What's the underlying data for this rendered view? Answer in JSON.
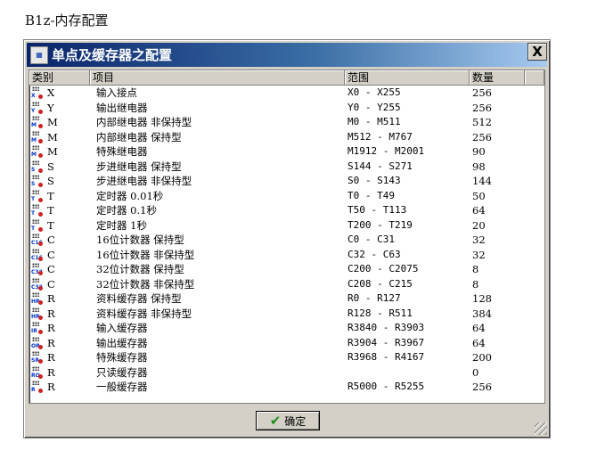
{
  "caption": "B1z-内存配置",
  "window": {
    "title": "单点及缓存器之配置",
    "close_label": "X",
    "ok_label": "确定"
  },
  "columns": [
    "类别",
    "项目",
    "范围",
    "数量"
  ],
  "rows": [
    {
      "icon": "X",
      "type": "X",
      "item": "输入接点",
      "range": "X0 - X255",
      "count": "256"
    },
    {
      "icon": "Y",
      "type": "Y",
      "item": "输出继电器",
      "range": "Y0 - Y255",
      "count": "256"
    },
    {
      "icon": "M",
      "type": "M",
      "item": "内部继电器 非保持型",
      "range": "M0 - M511",
      "count": "512"
    },
    {
      "icon": "M",
      "type": "M",
      "item": "内部继电器 保持型",
      "range": "M512 - M767",
      "count": "256"
    },
    {
      "icon": "M",
      "type": "M",
      "item": "特殊继电器",
      "range": "M1912 - M2001",
      "count": "90"
    },
    {
      "icon": "S",
      "type": "S",
      "item": "步进继电器 保持型",
      "range": "S144 - S271",
      "count": "98"
    },
    {
      "icon": "S",
      "type": "S",
      "item": "步进继电器 非保持型",
      "range": "S0 - S143",
      "count": "144"
    },
    {
      "icon": "T",
      "type": "T",
      "item": "定时器 0.01秒",
      "range": "T0 - T49",
      "count": "50"
    },
    {
      "icon": "T",
      "type": "T",
      "item": "定时器 0.1秒",
      "range": "T50 - T113",
      "count": "64"
    },
    {
      "icon": "T",
      "type": "T",
      "item": "定时器 1秒",
      "range": "T200 - T219",
      "count": "20"
    },
    {
      "icon": "C16",
      "type": "C",
      "item": "16位计数器 保持型",
      "range": "C0 - C31",
      "count": "32"
    },
    {
      "icon": "C16",
      "type": "C",
      "item": "16位计数器 非保持型",
      "range": "C32 - C63",
      "count": "32"
    },
    {
      "icon": "C32",
      "type": "C",
      "item": "32位计数器 保持型",
      "range": "C200 - C2075",
      "count": "8"
    },
    {
      "icon": "C32",
      "type": "C",
      "item": "32位计数器 非保持型",
      "range": "C208 - C215",
      "count": "8"
    },
    {
      "icon": "HR",
      "type": "R",
      "item": "资料缓存器 保持型",
      "range": "R0 - R127",
      "count": "128"
    },
    {
      "icon": "HR",
      "type": "R",
      "item": "资料缓存器 非保持型",
      "range": "R128 - R511",
      "count": "384"
    },
    {
      "icon": "IR",
      "type": "R",
      "item": "输入缓存器",
      "range": "R3840 - R3903",
      "count": "64"
    },
    {
      "icon": "OR",
      "type": "R",
      "item": "输出缓存器",
      "range": "R3904 - R3967",
      "count": "64"
    },
    {
      "icon": "SR",
      "type": "R",
      "item": "特殊缓存器",
      "range": "R3968 - R4167",
      "count": "200"
    },
    {
      "icon": "RO",
      "type": "R",
      "item": "只读缓存器",
      "range": "",
      "count": "0"
    },
    {
      "icon": "R",
      "type": "R",
      "item": "一般缓存器",
      "range": "R5000 - R5255",
      "count": "256"
    }
  ]
}
